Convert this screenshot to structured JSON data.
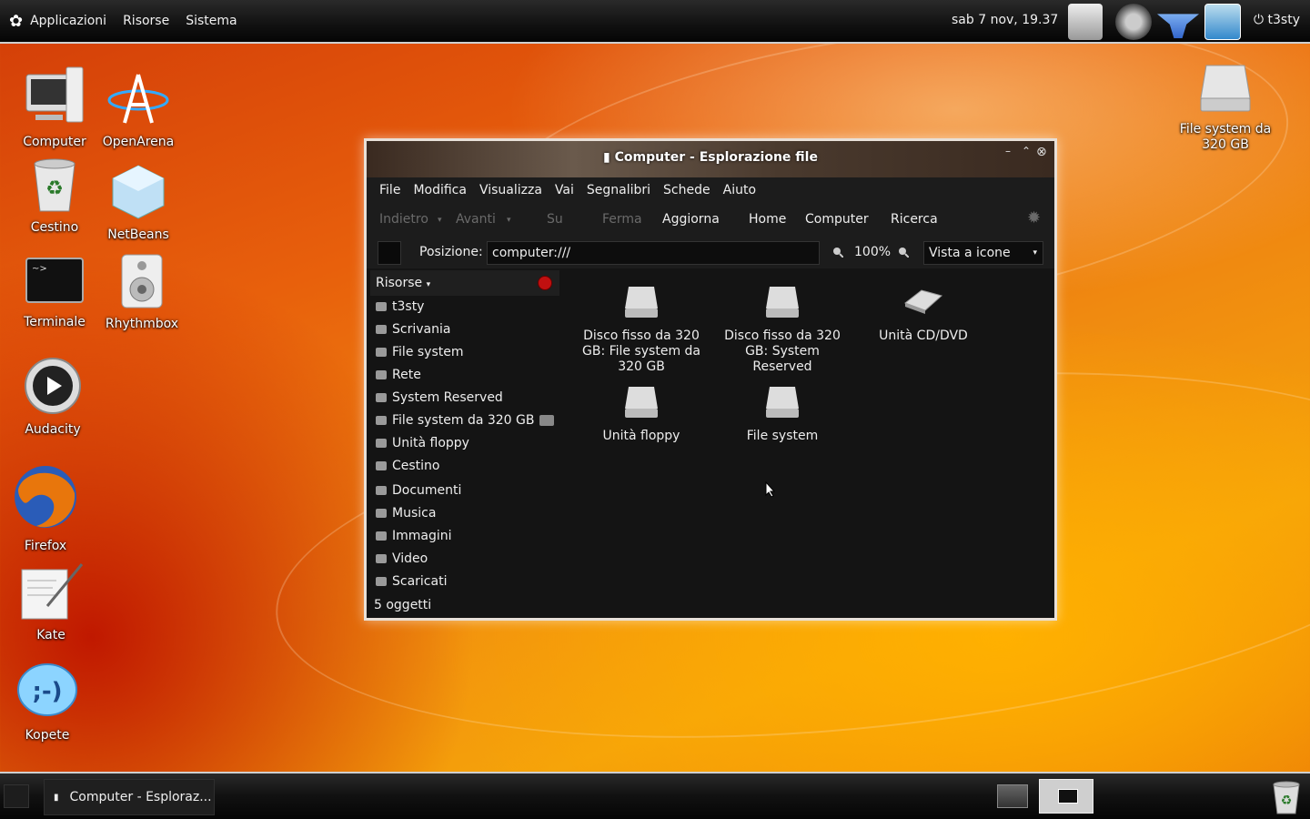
{
  "top_panel": {
    "menus": [
      "Applicazioni",
      "Risorse",
      "Sistema"
    ],
    "clock": "sab  7 nov, 19.37",
    "user": "t3sty"
  },
  "desktop_icons": {
    "computer": "Computer",
    "openarena": "OpenArena",
    "cestino": "Cestino",
    "netbeans": "NetBeans",
    "terminale": "Terminale",
    "rhythmbox": "Rhythmbox",
    "audacity": "Audacity",
    "firefox": "Firefox",
    "kate": "Kate",
    "kopete": "Kopete",
    "filesystem": "File system da 320 GB"
  },
  "window": {
    "title": "Computer - Esplorazione file",
    "menubar": [
      "File",
      "Modifica",
      "Visualizza",
      "Vai",
      "Segnalibri",
      "Schede",
      "Aiuto"
    ],
    "toolbar": {
      "back": "Indietro",
      "forward": "Avanti",
      "up": "Su",
      "stop": "Ferma",
      "reload": "Aggiorna",
      "home": "Home",
      "computer": "Computer",
      "search": "Ricerca"
    },
    "location": {
      "label": "Posizione:",
      "value": "computer:///",
      "zoom": "100%",
      "view": "Vista a icone"
    },
    "sidepane": {
      "title": "Risorse",
      "places": [
        "t3sty",
        "Scrivania",
        "File system",
        "Rete",
        "System Reserved",
        "File system da 320 GB",
        "Unità floppy",
        "Cestino"
      ],
      "bookmarks": [
        "Documenti",
        "Musica",
        "Immagini",
        "Video",
        "Scaricati"
      ]
    },
    "files": [
      "Disco fisso da 320 GB: File system da 320 GB",
      "Disco fisso da 320 GB: System Reserved",
      "Unità CD/DVD",
      "Unità floppy",
      "File system"
    ],
    "status": "5 oggetti"
  },
  "taskbar": {
    "task": "Computer - Esploraz..."
  },
  "colors": {
    "panel": "#111111",
    "window_bg": "#141414",
    "accent_red": "#c01010"
  }
}
